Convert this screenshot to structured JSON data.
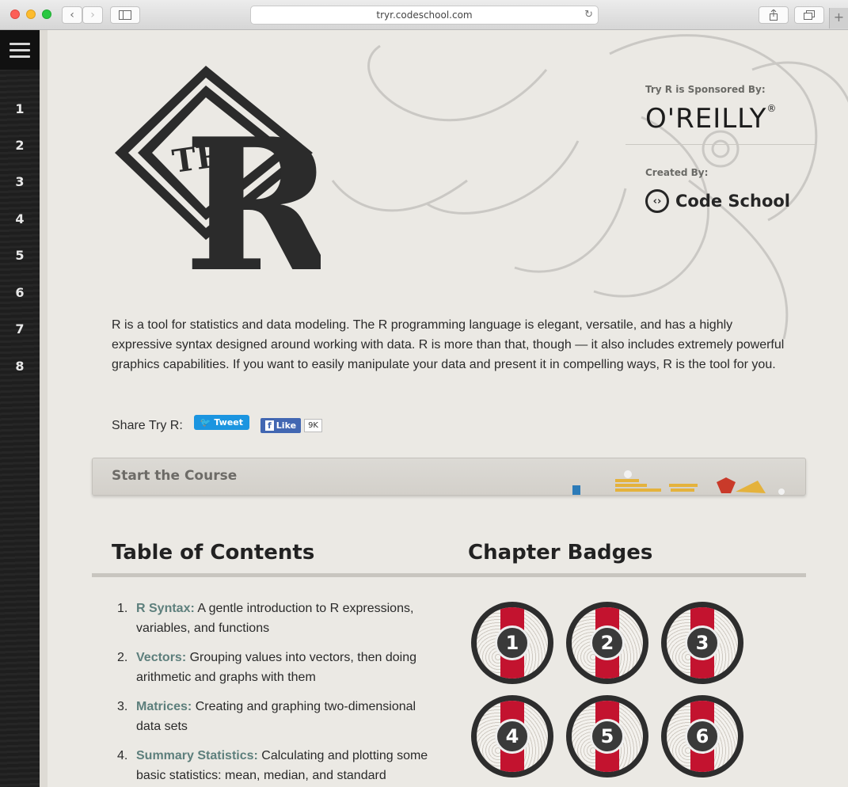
{
  "browser": {
    "url": "tryr.codeschool.com"
  },
  "sidebar": {
    "chapters": [
      "1",
      "2",
      "3",
      "4",
      "5",
      "6",
      "7",
      "8"
    ]
  },
  "sponsor": {
    "sponsored_label": "Try R is Sponsored By:",
    "sponsor_name": "O'REILLY",
    "registered_mark": "®",
    "created_label": "Created By:",
    "creator_name": "Code School"
  },
  "logo": {
    "text_try": "TRY",
    "text_r": "R"
  },
  "intro": {
    "text": "R is a tool for statistics and data modeling. The R programming language is elegant, versatile, and has a highly expressive syntax designed around working with data. R is more than that, though — it also includes extremely powerful graphics capabilities. If you want to easily manipulate your data and present it in compelling ways, R is the tool for you."
  },
  "share": {
    "label": "Share Try R:",
    "tweet": "Tweet",
    "like": "Like",
    "like_count": "9K"
  },
  "start": {
    "label": "Start the Course"
  },
  "toc": {
    "heading": "Table of Contents",
    "items": [
      {
        "num": "1.",
        "title": "R Syntax:",
        "desc": " A gentle introduction to R expressions, variables, and functions"
      },
      {
        "num": "2.",
        "title": "Vectors:",
        "desc": " Grouping values into vectors, then doing arithmetic and graphs with them"
      },
      {
        "num": "3.",
        "title": "Matrices:",
        "desc": " Creating and graphing two-dimensional data sets"
      },
      {
        "num": "4.",
        "title": "Summary Statistics:",
        "desc": " Calculating and plotting some basic statistics: mean, median, and standard"
      }
    ]
  },
  "badges": {
    "heading": "Chapter Badges",
    "items": [
      "1",
      "2",
      "3",
      "4",
      "5",
      "6"
    ]
  }
}
